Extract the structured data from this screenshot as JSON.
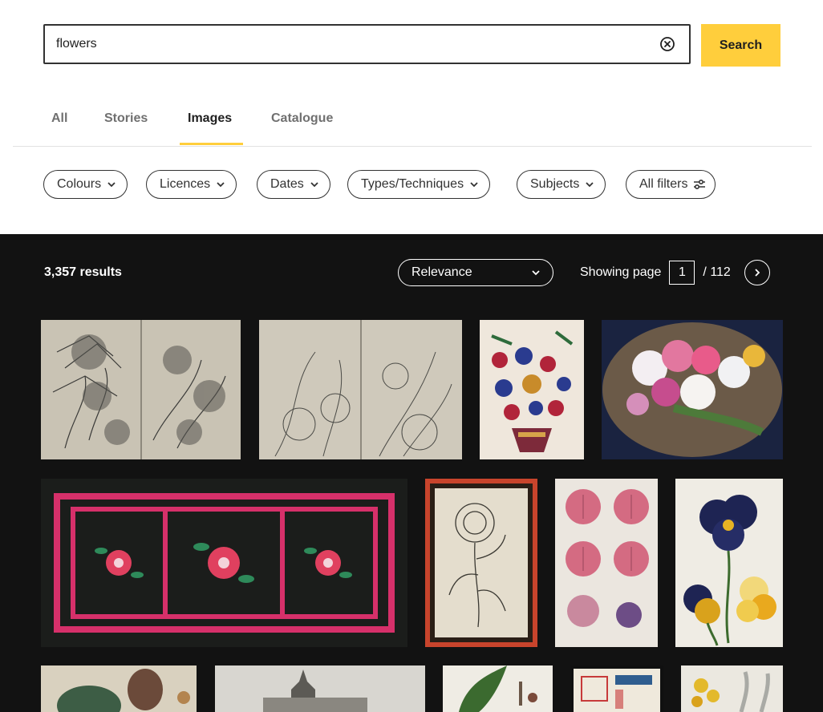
{
  "search": {
    "value": "flowers",
    "button_label": "Search",
    "clear_icon": "clear-circle-icon"
  },
  "tabs": [
    {
      "label": "All",
      "active": false
    },
    {
      "label": "Stories",
      "active": false
    },
    {
      "label": "Images",
      "active": true
    },
    {
      "label": "Catalogue",
      "active": false
    }
  ],
  "filters": [
    "Colours",
    "Licences",
    "Dates",
    "Types/Techniques",
    "Subjects"
  ],
  "all_filters_label": "All filters",
  "results": {
    "count_text": "3,357 results",
    "sort_label": "Relevance",
    "showing_page_label": "Showing page",
    "current_page": "1",
    "total_pages_text": "/ 112"
  },
  "colors": {
    "accent": "#ffce3c",
    "dark_bg": "#121212",
    "border": "#323232"
  }
}
